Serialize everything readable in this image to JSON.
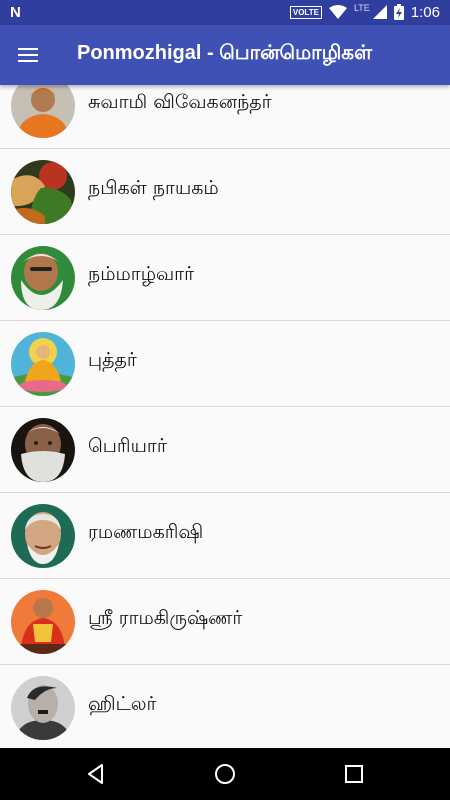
{
  "status_bar": {
    "app_icon": "N",
    "volte": "VOLTE",
    "network": "LTE",
    "battery_icon": "battery-charging-icon",
    "time": "1:06"
  },
  "app_bar": {
    "menu_icon": "hamburger-menu-icon",
    "title": "Ponmozhigal - பொன்மொழிகள்"
  },
  "items": [
    {
      "label": "சுவாமி விவேகனந்தர்",
      "avatar": "swami-vivekananda-avatar"
    },
    {
      "label": "நபிகள் நாயகம்",
      "avatar": "nabigal-nayagam-avatar"
    },
    {
      "label": "நம்மாழ்வார்",
      "avatar": "nammalvar-avatar"
    },
    {
      "label": "புத்தர்",
      "avatar": "buddha-avatar"
    },
    {
      "label": "பெரியார்",
      "avatar": "periyar-avatar"
    },
    {
      "label": "ரமணமகரிஷி",
      "avatar": "ramana-maharishi-avatar"
    },
    {
      "label": "ஸ்ரீ ராமகிருஷ்ணர்",
      "avatar": "sri-ramakrishnar-avatar"
    },
    {
      "label": "ஹிட்லர்",
      "avatar": "hitler-avatar"
    }
  ],
  "nav_bar": {
    "back_icon": "back-triangle-icon",
    "home_icon": "home-circle-icon",
    "recents_icon": "recents-square-icon"
  },
  "colors": {
    "status_bar": "#303f9f",
    "app_bar": "#3f51b5",
    "list_bg": "#fafafa",
    "divider": "#d9d9d9"
  }
}
